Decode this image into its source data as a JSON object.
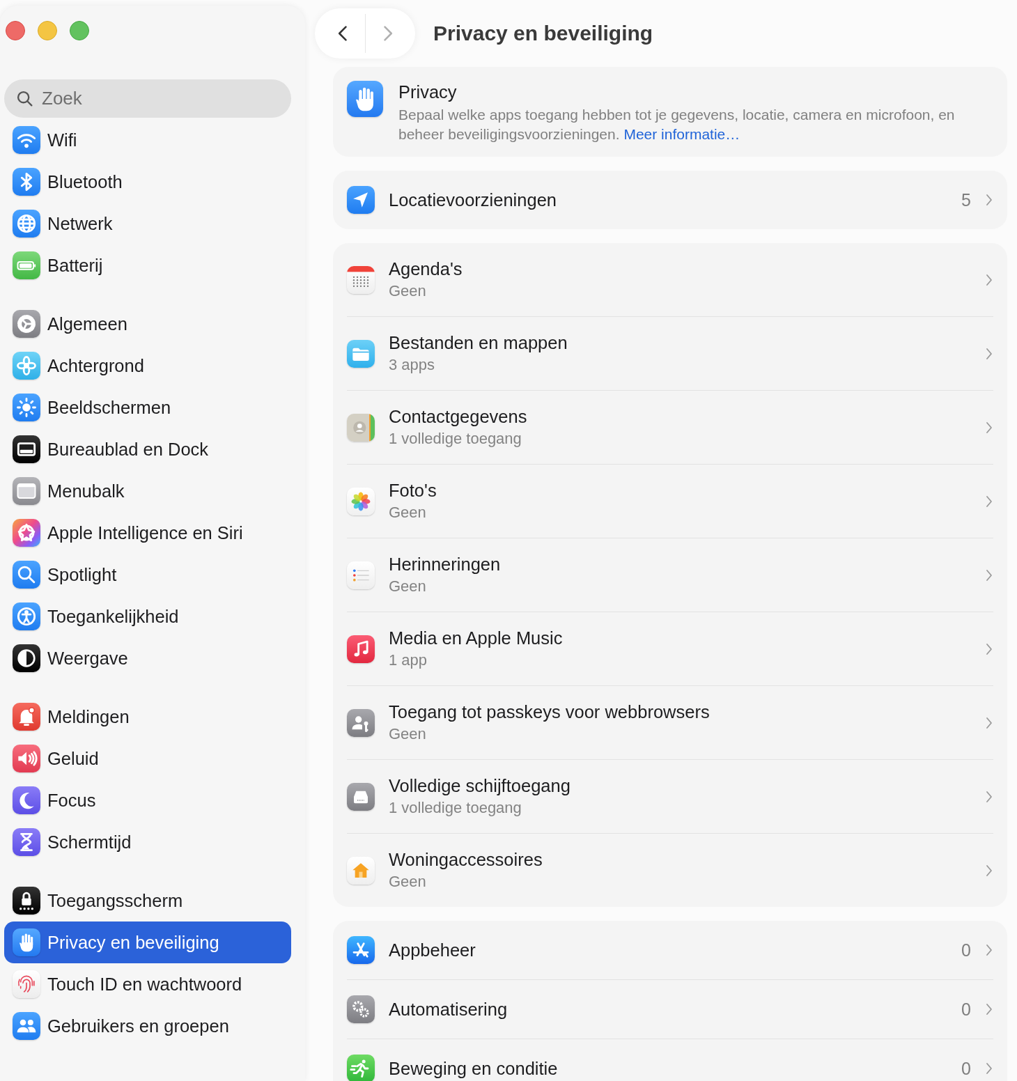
{
  "sidebar": {
    "search": {
      "placeholder": "Zoek"
    },
    "groups": [
      {
        "items": [
          {
            "label": "Wifi",
            "kind": "wifi",
            "selected": false
          },
          {
            "label": "Bluetooth",
            "kind": "bluetooth",
            "selected": false
          },
          {
            "label": "Netwerk",
            "kind": "globe",
            "selected": false
          },
          {
            "label": "Batterij",
            "kind": "battery",
            "selected": false
          }
        ]
      },
      {
        "items": [
          {
            "label": "Algemeen",
            "kind": "gear",
            "selected": false
          },
          {
            "label": "Achtergrond",
            "kind": "flower",
            "selected": false
          },
          {
            "label": "Beeldschermen",
            "kind": "sun",
            "selected": false
          },
          {
            "label": "Bureaublad en Dock",
            "kind": "dock",
            "selected": false
          },
          {
            "label": "Menubalk",
            "kind": "menubar",
            "selected": false
          },
          {
            "label": "Apple Intelligence en Siri",
            "kind": "siri",
            "selected": false
          },
          {
            "label": "Spotlight",
            "kind": "magnifier",
            "selected": false
          },
          {
            "label": "Toegankelijkheid",
            "kind": "accessibility",
            "selected": false
          },
          {
            "label": "Weergave",
            "kind": "appearance",
            "selected": false
          }
        ]
      },
      {
        "items": [
          {
            "label": "Meldingen",
            "kind": "bell",
            "selected": false
          },
          {
            "label": "Geluid",
            "kind": "speaker",
            "selected": false
          },
          {
            "label": "Focus",
            "kind": "moon",
            "selected": false
          },
          {
            "label": "Schermtijd",
            "kind": "hourglass",
            "selected": false
          }
        ]
      },
      {
        "items": [
          {
            "label": "Toegangsscherm",
            "kind": "lock",
            "selected": false
          },
          {
            "label": "Privacy en beveiliging",
            "kind": "hand",
            "selected": true
          },
          {
            "label": "Touch ID en wachtwoord",
            "kind": "fingerprint",
            "selected": false
          },
          {
            "label": "Gebruikers en groepen",
            "kind": "users",
            "selected": false
          }
        ]
      }
    ]
  },
  "toolbar": {
    "nav": [
      {
        "kind": "back",
        "disabled": false
      },
      {
        "kind": "forward",
        "disabled": true
      }
    ],
    "title": "Privacy en beveiliging"
  },
  "intro": {
    "kind": "hand",
    "title": "Privacy",
    "text": "Bepaal welke apps toegang hebben tot je gegevens, locatie, camera en microfoon, en beheer beveiligingsvoorzieningen.",
    "link": "Meer informatie…"
  },
  "sections": [
    {
      "rows": [
        {
          "label": "Locatievoorzieningen",
          "kind": "location",
          "value": "5"
        }
      ]
    },
    {
      "rows": [
        {
          "label": "Agenda's",
          "kind": "calendar",
          "sub": "Geen"
        },
        {
          "label": "Bestanden en mappen",
          "kind": "folder",
          "sub": "3 apps"
        },
        {
          "label": "Contactgegevens",
          "kind": "contacts",
          "sub": "1 volledige toegang"
        },
        {
          "label": "Foto's",
          "kind": "photos",
          "sub": "Geen"
        },
        {
          "label": "Herinneringen",
          "kind": "reminders",
          "sub": "Geen"
        },
        {
          "label": "Media en Apple Music",
          "kind": "music",
          "sub": "1 app"
        },
        {
          "label": "Toegang tot passkeys voor webbrowsers",
          "kind": "passkey",
          "sub": "Geen"
        },
        {
          "label": "Volledige schijftoegang",
          "kind": "disk",
          "sub": "1 volledige toegang"
        },
        {
          "label": "Woningaccessoires",
          "kind": "home",
          "sub": "Geen"
        }
      ]
    },
    {
      "rows": [
        {
          "label": "Appbeheer",
          "kind": "appstore",
          "value": "0"
        },
        {
          "label": "Automatisering",
          "kind": "gears",
          "value": "0"
        },
        {
          "label": "Beweging en conditie",
          "kind": "runner",
          "value": "0"
        }
      ]
    }
  ]
}
